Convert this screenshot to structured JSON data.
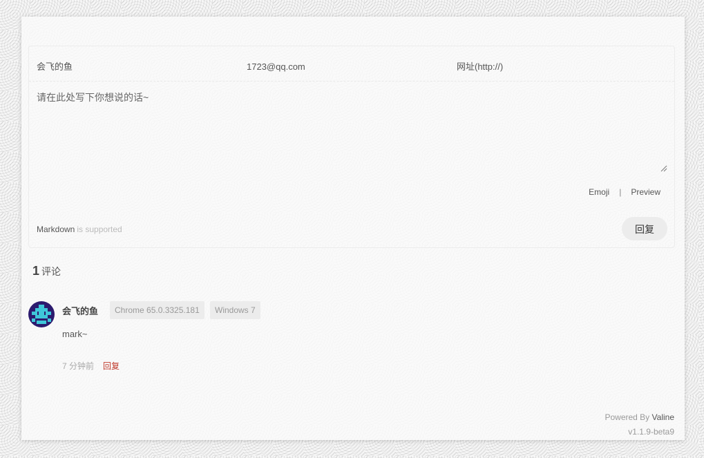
{
  "editor": {
    "nick_placeholder": "会飞的鱼",
    "mail_placeholder": "1723@qq.com",
    "link_placeholder": "网址(http://)",
    "content_placeholder": "请在此处写下你想说的话~",
    "emoji_label": "Emoji",
    "separator": "|",
    "preview_label": "Preview",
    "markdown_label": "Markdown",
    "markdown_suffix": "is supported",
    "submit_label": "回复"
  },
  "comments_count": {
    "number": "1",
    "label": "评论"
  },
  "comments": [
    {
      "nick": "会飞的鱼",
      "browser": "Chrome 65.0.3325.181",
      "os": "Windows 7",
      "content": "mark~",
      "time": "7 分钟前",
      "reply_label": "回复"
    }
  ],
  "footer": {
    "powered_prefix": "Powered By",
    "powered_brand": "Valine",
    "version": "v1.1.9-beta9"
  },
  "colors": {
    "accent_reply": "#c0392b",
    "avatar_bg": "#2c1b6e",
    "avatar_fg": "#3fc7d9"
  }
}
